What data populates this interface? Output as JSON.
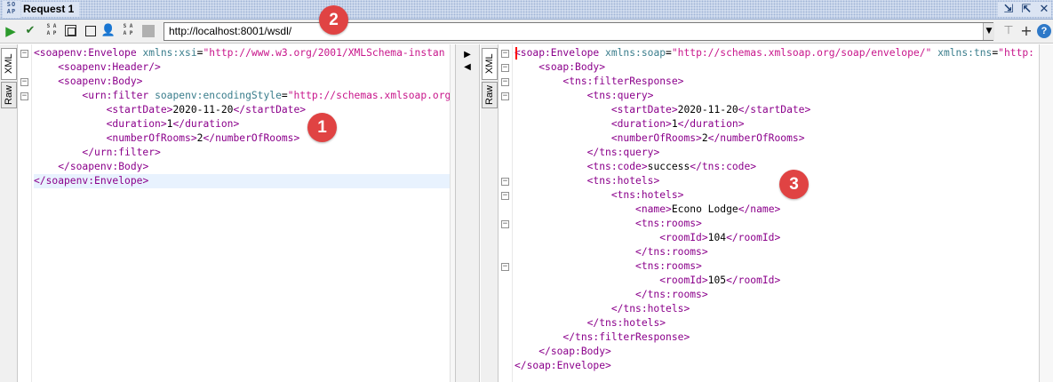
{
  "window": {
    "title": "Request 1",
    "logo_text": "SO\nAP"
  },
  "toolbar": {
    "url": "http://localhost:8001/wsdl/",
    "play_icon": "play-icon",
    "help_label": "?"
  },
  "annotations": [
    "1",
    "2",
    "3"
  ],
  "left_panel": {
    "tabs": [
      "XML",
      "Raw"
    ],
    "lines": [
      "<soapenv:Envelope xmlns:xsi=\"http://www.w3.org/2001/XMLSchema-instan",
      "    <soapenv:Header/>",
      "    <soapenv:Body>",
      "        <urn:filter soapenv:encodingStyle=\"http://schemas.xmlsoap.org/",
      "            <startDate>2020-11-20</startDate>",
      "            <duration>1</duration>",
      "            <numberOfRooms>2</numberOfRooms>",
      "        </urn:filter>",
      "    </soapenv:Body>",
      "</soapenv:Envelope>"
    ]
  },
  "right_panel": {
    "tabs": [
      "XML",
      "Raw"
    ],
    "lines": [
      "<soap:Envelope xmlns:soap=\"http://schemas.xmlsoap.org/soap/envelope/\" xmlns:tns=\"http:",
      "    <soap:Body>",
      "        <tns:filterResponse>",
      "            <tns:query>",
      "                <startDate>2020-11-20</startDate>",
      "                <duration>1</duration>",
      "                <numberOfRooms>2</numberOfRooms>",
      "            </tns:query>",
      "            <tns:code>success</tns:code>",
      "            <tns:hotels>",
      "                <tns:hotels>",
      "                    <name>Econo Lodge</name>",
      "                    <tns:rooms>",
      "                        <roomId>104</roomId>",
      "                    </tns:rooms>",
      "                    <tns:rooms>",
      "                        <roomId>105</roomId>",
      "                    </tns:rooms>",
      "                </tns:hotels>",
      "            </tns:hotels>",
      "        </tns:filterResponse>",
      "    </soap:Body>",
      "</soap:Envelope>"
    ]
  },
  "colors": {
    "tag": "#8b008b",
    "attr": "#3a7d8c",
    "value": "#c8168b",
    "badge": "#e04343"
  }
}
